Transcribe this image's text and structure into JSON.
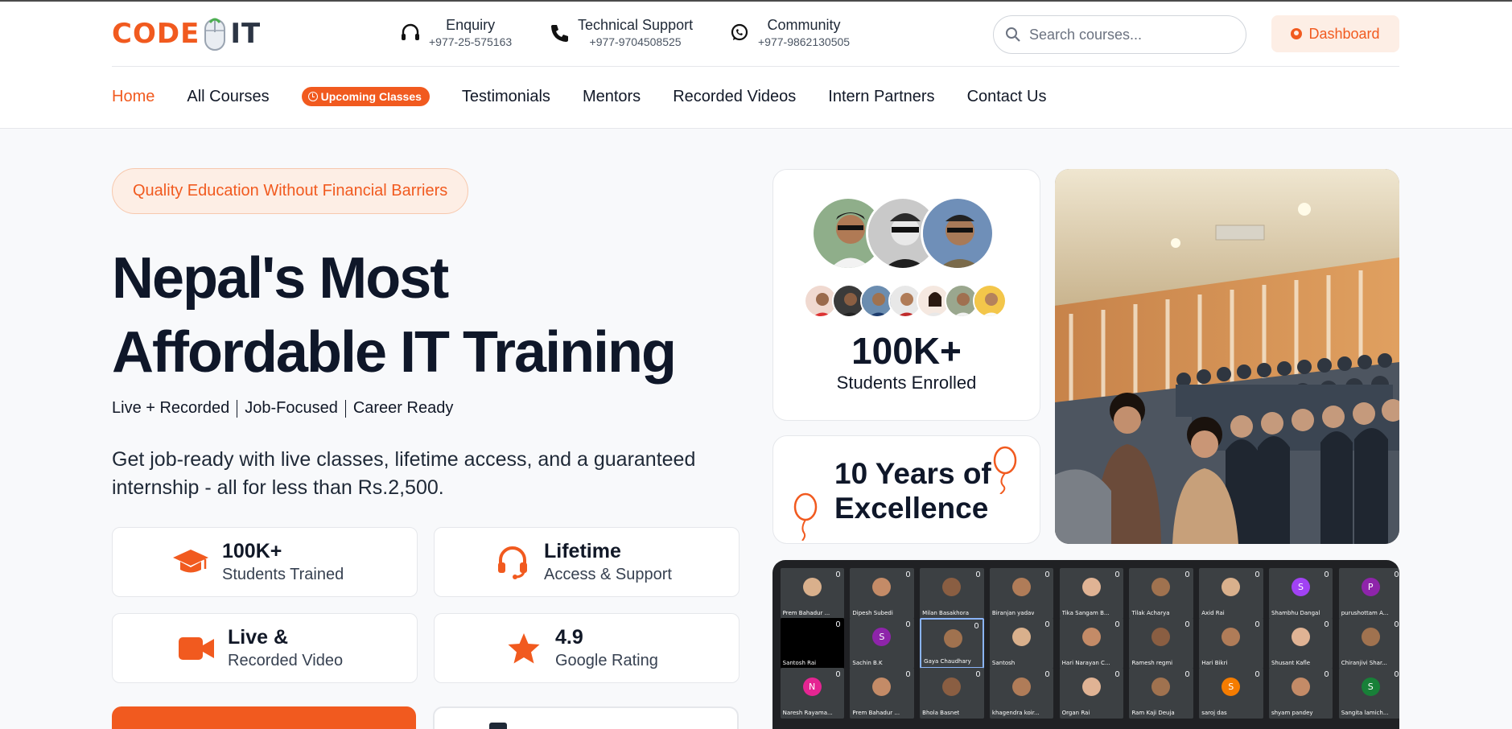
{
  "brand": {
    "code": "CODE",
    "it": "IT"
  },
  "contacts": [
    {
      "title": "Enquiry",
      "phone": "+977-25-575163",
      "icon": "headset-icon"
    },
    {
      "title": "Technical Support",
      "phone": "+977-9704508525",
      "icon": "phone-icon"
    },
    {
      "title": "Community",
      "phone": "+977-9862130505",
      "icon": "whatsapp-icon"
    }
  ],
  "search": {
    "placeholder": "Search courses..."
  },
  "dashboard_label": "Dashboard",
  "nav": {
    "home": "Home",
    "all_courses": "All Courses",
    "upcoming": "Upcoming Classes",
    "testimonials": "Testimonials",
    "mentors": "Mentors",
    "recorded": "Recorded Videos",
    "intern": "Intern Partners",
    "contact": "Contact Us"
  },
  "hero": {
    "badge": "Quality Education Without Financial Barriers",
    "headline_line1": "Nepal's Most",
    "headline_line2": "Affordable IT Training",
    "sub1": "Live + Recorded",
    "sub2": "Job-Focused",
    "sub3": "Career Ready",
    "description": "Get job-ready with live classes, lifetime access, and a guaranteed internship - all for less than Rs.2,500."
  },
  "features": [
    {
      "title": "100K+",
      "subtitle": "Students Trained",
      "icon": "graduation-cap-icon"
    },
    {
      "title": "Lifetime",
      "subtitle": "Access & Support",
      "icon": "headset-icon"
    },
    {
      "title": "Live &",
      "subtitle": "Recorded Video",
      "icon": "video-camera-icon"
    },
    {
      "title": "4.9",
      "subtitle": "Google Rating",
      "icon": "star-icon"
    }
  ],
  "stats": {
    "enrolled_value": "100K+",
    "enrolled_label": "Students Enrolled",
    "years_line1": "10 Years of",
    "years_line2": "Excellence"
  },
  "meeting": {
    "row1": [
      "Prem Bahadur ...",
      "Dipesh Subedi",
      "Milan Basakhora",
      "Biranjan yadav",
      "Tika Sangam B...",
      "Tilak Acharya",
      "Axid Rai",
      "Shambhu Dangal",
      "purushottam A..."
    ],
    "row2": [
      "Santosh Rai",
      "Sachin B.K",
      "Gaya Chaudhary",
      "Santosh",
      "Hari Narayan C...",
      "Ramesh regmi",
      "Hari Bikri",
      "Shusant Kafle",
      "Chiranjivi Shar..."
    ],
    "row3": [
      "Naresh Rayama...",
      "Prem Bahadur ...",
      "Bhola Basnet",
      "khagendra koir...",
      "Organ Rai",
      "Ram Kaji Deuja",
      "saroj das",
      "shyam pandey",
      "Sangita lamich..."
    ],
    "initials": {
      "r1c8": "S",
      "r1c9": "P",
      "r2c2": "S",
      "r3c1": "N",
      "r3c7": "S",
      "r3c9": "S"
    }
  },
  "colors": {
    "accent": "#f15a1f",
    "dark": "#0f1729",
    "meeting_bg": "#202124"
  }
}
